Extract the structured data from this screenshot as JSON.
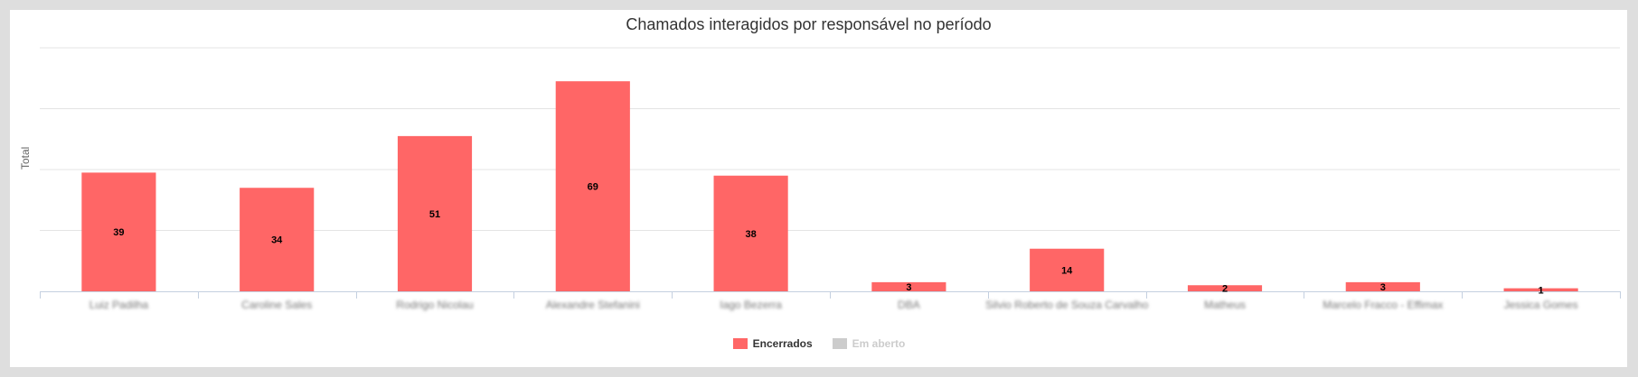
{
  "chart_data": {
    "type": "bar",
    "title": "Chamados interagidos por responsável no período",
    "ylabel": "Total",
    "xlabel": "",
    "categories": [
      "Luiz Padilha",
      "Caroline Sales",
      "Rodrigo Nicolau",
      "Alexandre Stefanini",
      "Iago Bezerra",
      "DBA",
      "Silvio Roberto de Souza Carvalho",
      "Matheus",
      "Marcelo Fracco - Effimax",
      "Jessica Gomes"
    ],
    "series": [
      {
        "name": "Encerrados",
        "color": "#ff6666",
        "values": [
          39,
          34,
          51,
          69,
          38,
          3,
          14,
          2,
          3,
          1
        ],
        "visible": true
      },
      {
        "name": "Em aberto",
        "color": "#cccccc",
        "values": [
          0,
          0,
          0,
          0,
          0,
          0,
          0,
          0,
          0,
          0
        ],
        "visible": false
      }
    ],
    "ylim": [
      0,
      80
    ],
    "grid": true,
    "legend": "bottom-center",
    "data_labels": true,
    "category_labels_blurred": true
  }
}
